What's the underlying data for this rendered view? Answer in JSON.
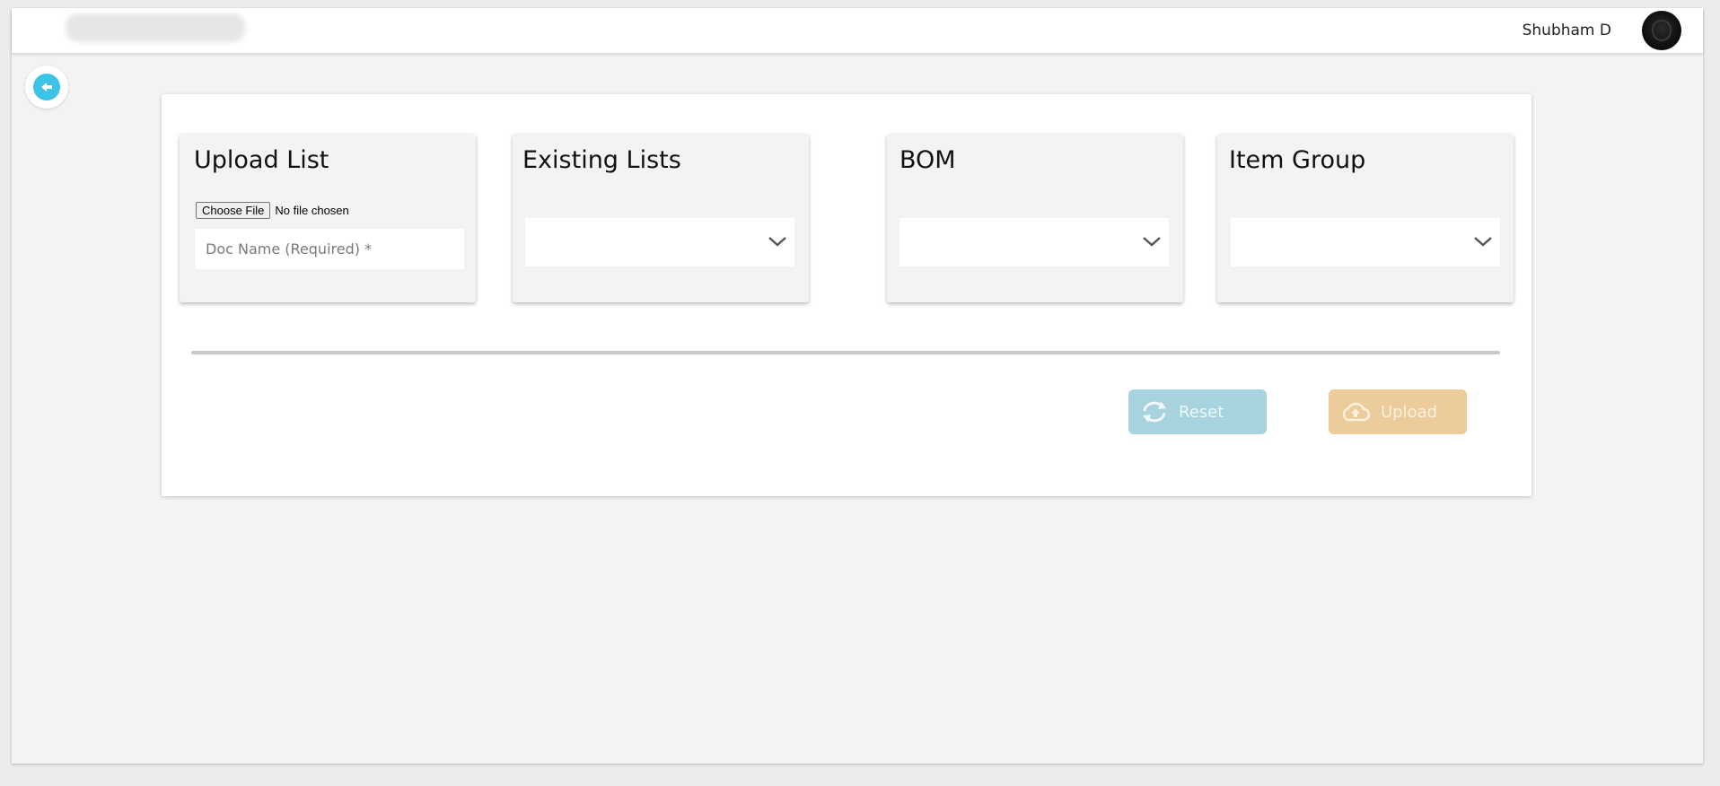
{
  "header": {
    "user_name": "Shubham D",
    "avatar_icon": "user-avatar"
  },
  "back_icon": "arrow-left-icon",
  "cards": {
    "upload": {
      "title": "Upload List",
      "choose_file_label": "Choose File",
      "file_status": "No file chosen",
      "doc_name_placeholder": "Doc Name (Required) *",
      "doc_name_value": ""
    },
    "existing": {
      "title": "Existing Lists",
      "selected": ""
    },
    "bom": {
      "title": "BOM",
      "selected": ""
    },
    "item_group": {
      "title": "Item Group",
      "selected": ""
    }
  },
  "actions": {
    "reset_label": "Reset",
    "upload_label": "Upload",
    "reset_icon": "refresh-icon",
    "upload_icon": "cloud-upload-icon"
  },
  "colors": {
    "accent_blue": "#3cc3e8",
    "reset_bg": "#a7d3de",
    "upload_bg": "#eccc9b"
  }
}
